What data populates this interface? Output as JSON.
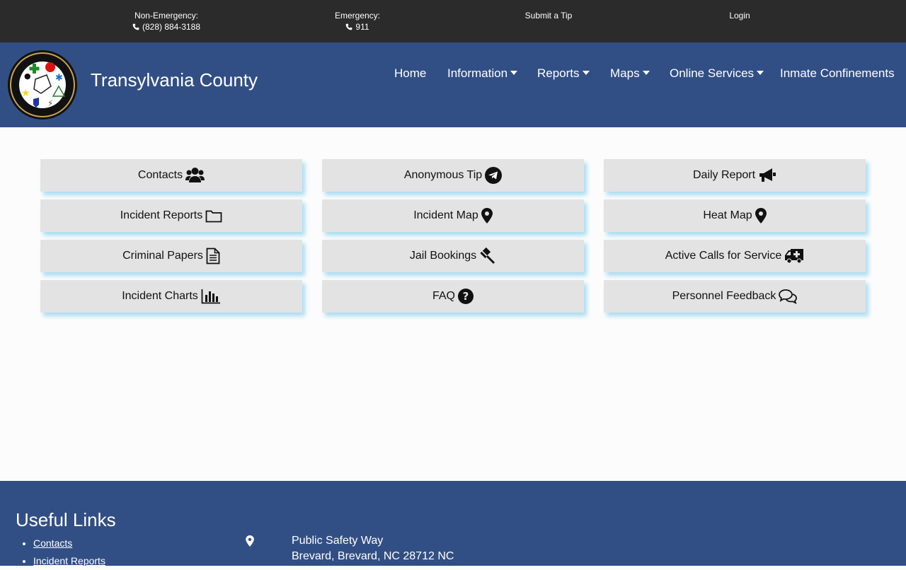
{
  "topbar": {
    "non_emergency_label": "Non-Emergency:",
    "non_emergency_phone": "(828) 884-3188",
    "emergency_label": "Emergency:",
    "emergency_phone": "911",
    "submit_tip": "Submit a Tip",
    "login": "Login"
  },
  "header": {
    "title": "Transylvania County",
    "logo_text_top": "TRANSYLVANIA COUNTY",
    "logo_text_bottom": "EMERGENCY SERVICES"
  },
  "nav": {
    "home": "Home",
    "information": "Information",
    "reports": "Reports",
    "maps": "Maps",
    "online_services": "Online Services",
    "inmate": "Inmate Confinements"
  },
  "tiles": [
    {
      "label": "Contacts",
      "icon": "users-icon"
    },
    {
      "label": "Anonymous Tip",
      "icon": "telegram-icon"
    },
    {
      "label": "Daily Report",
      "icon": "bullhorn-icon"
    },
    {
      "label": "Incident Reports",
      "icon": "folder-icon"
    },
    {
      "label": "Incident Map",
      "icon": "map-marker-icon"
    },
    {
      "label": "Heat Map",
      "icon": "map-marker-icon"
    },
    {
      "label": "Criminal Papers",
      "icon": "file-text-icon"
    },
    {
      "label": "Jail Bookings",
      "icon": "gavel-icon"
    },
    {
      "label": "Active Calls for Service",
      "icon": "ambulance-icon"
    },
    {
      "label": "Incident Charts",
      "icon": "bar-chart-icon"
    },
    {
      "label": "FAQ",
      "icon": "question-circle-icon"
    },
    {
      "label": "Personnel Feedback",
      "icon": "comments-icon"
    }
  ],
  "footer": {
    "heading": "Useful Links",
    "links": [
      "Contacts",
      "Incident Reports"
    ],
    "address_line1": "Public Safety Way",
    "address_line2": "Brevard, Brevard, NC 28712 NC"
  },
  "colors": {
    "topbar_bg": "#2b2b2b",
    "brand_blue": "#324f85",
    "tile_bg": "#e3e3e3",
    "tile_shadow": "#a9dcf0"
  }
}
